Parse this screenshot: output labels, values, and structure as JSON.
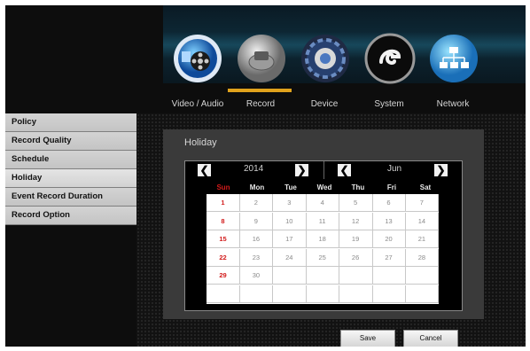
{
  "top_tabs": [
    {
      "label": "Video / Audio",
      "icon": "film-reel-icon"
    },
    {
      "label": "Record",
      "icon": "hard-disk-icon"
    },
    {
      "label": "Device",
      "icon": "device-gear-icon"
    },
    {
      "label": "System",
      "icon": "system-swirl-icon"
    },
    {
      "label": "Network",
      "icon": "network-icon"
    }
  ],
  "active_tab": "Record",
  "sidebar": {
    "items": [
      {
        "label": "Policy"
      },
      {
        "label": "Record Quality"
      },
      {
        "label": "Schedule"
      },
      {
        "label": "Holiday"
      },
      {
        "label": "Event Record Duration"
      },
      {
        "label": "Record Option"
      }
    ],
    "active": "Holiday"
  },
  "panel": {
    "title": "Holiday"
  },
  "calendar": {
    "year": "2014",
    "month": "Jun",
    "prev_symbol": "❮",
    "next_symbol": "❯",
    "weekdays": [
      "Sun",
      "Mon",
      "Tue",
      "Wed",
      "Thu",
      "Fri",
      "Sat"
    ],
    "weeks": [
      [
        "1",
        "2",
        "3",
        "4",
        "5",
        "6",
        "7"
      ],
      [
        "8",
        "9",
        "10",
        "11",
        "12",
        "13",
        "14"
      ],
      [
        "15",
        "16",
        "17",
        "18",
        "19",
        "20",
        "21"
      ],
      [
        "22",
        "23",
        "24",
        "25",
        "26",
        "27",
        "28"
      ],
      [
        "29",
        "30",
        "",
        "",
        "",
        "",
        ""
      ],
      [
        "",
        "",
        "",
        "",
        "",
        "",
        ""
      ]
    ]
  },
  "buttons": {
    "save": "Save",
    "cancel": "Cancel"
  },
  "colors": {
    "accent_underline": "#e0a21c",
    "sunday": "#d21a1a"
  }
}
